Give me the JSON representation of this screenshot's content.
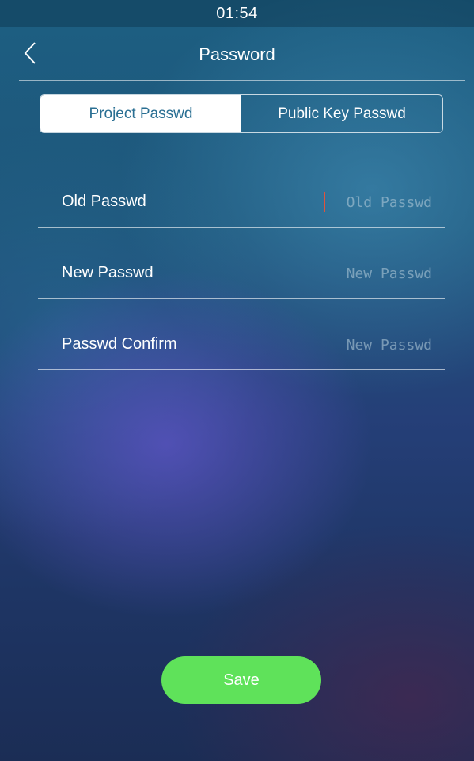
{
  "status_bar": {
    "time": "01:54"
  },
  "header": {
    "title": "Password",
    "back_icon": "chevron-left-icon"
  },
  "tabs": [
    {
      "label": "Project Passwd",
      "active": true
    },
    {
      "label": "Public Key Passwd",
      "active": false
    }
  ],
  "fields": [
    {
      "label": "Old Passwd",
      "placeholder": "Old Passwd",
      "value": ""
    },
    {
      "label": "New Passwd",
      "placeholder": "New Passwd",
      "value": ""
    },
    {
      "label": "Passwd Confirm",
      "placeholder": "New Passwd",
      "value": ""
    }
  ],
  "save_button": {
    "label": "Save",
    "color": "#5fe25a"
  },
  "colors": {
    "accent": "#2a6f93",
    "caret": "#e0533c"
  }
}
